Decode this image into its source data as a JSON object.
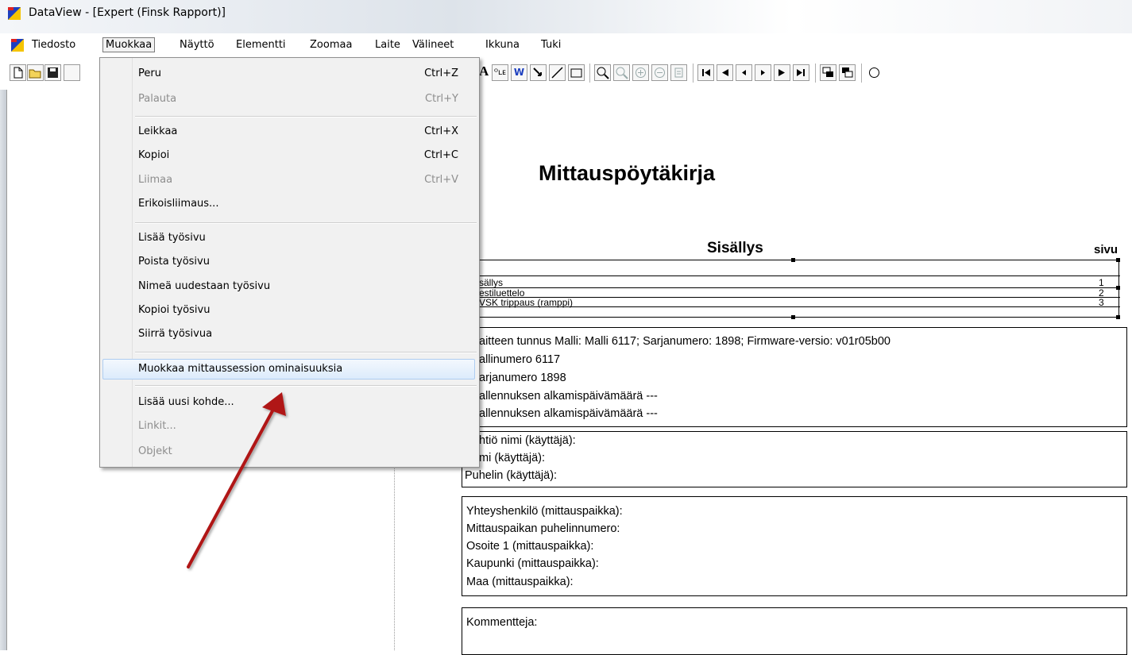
{
  "window": {
    "title": "DataView - [Expert (Finsk Rapport)]"
  },
  "menubar": {
    "items": [
      "Tiedosto",
      "Muokkaa",
      "Näyttö",
      "Elementti",
      "Zoomaa",
      "Laite",
      "Välineet",
      "Ikkuna",
      "Tuki"
    ],
    "active": "Muokkaa"
  },
  "toolbar": {
    "text_glyphs": [
      "A",
      "ᴼʟᴇ",
      "W"
    ]
  },
  "edit_menu": {
    "items": [
      {
        "label": "Peru",
        "shortcut": "Ctrl+Z",
        "enabled": true
      },
      {
        "label": "Palauta",
        "shortcut": "Ctrl+Y",
        "enabled": false
      },
      {
        "label": "Leikkaa",
        "shortcut": "Ctrl+X",
        "enabled": true
      },
      {
        "label": "Kopioi",
        "shortcut": "Ctrl+C",
        "enabled": true
      },
      {
        "label": "Liimaa",
        "shortcut": "Ctrl+V",
        "enabled": false
      },
      {
        "label": "Erikoisliimaus...",
        "shortcut": "",
        "enabled": true
      },
      {
        "label": "Lisää työsivu",
        "shortcut": "",
        "enabled": true
      },
      {
        "label": "Poista työsivu",
        "shortcut": "",
        "enabled": true
      },
      {
        "label": "Nimeä uudestaan työsivu",
        "shortcut": "",
        "enabled": true
      },
      {
        "label": "Kopioi työsivu",
        "shortcut": "",
        "enabled": true
      },
      {
        "label": "Siirrä työsivua",
        "shortcut": "",
        "enabled": true
      },
      {
        "label": "Muokkaa mittaussession ominaisuuksia",
        "shortcut": "",
        "enabled": true,
        "highlighted": true
      },
      {
        "label": "Lisää uusi kohde...",
        "shortcut": "",
        "enabled": true
      },
      {
        "label": "Linkit...",
        "shortcut": "",
        "enabled": false
      },
      {
        "label": "Objekt",
        "shortcut": "",
        "enabled": false
      }
    ]
  },
  "document": {
    "title": "Mittauspöytäkirja",
    "toc_heading": "Sisällys",
    "toc_page_heading": "sivu",
    "toc_entries": [
      {
        "label": "sällys",
        "page": "1"
      },
      {
        "label": "estiluettelo",
        "page": "2"
      },
      {
        "label": "VSK trippaus (ramppi)",
        "page": "3"
      }
    ],
    "device_box": [
      "aitteen tunnus Malli: Malli 6117; Sarjanumero: 1898; Firmware-versio: v01r05b00",
      "allinumero 6117",
      "arjanumero 1898",
      "allennuksen alkamispäivämäärä ---",
      "allennuksen alkamispäivämäärä ---"
    ],
    "user_box": [
      "htiö nimi (käyttäjä):",
      "mi (käyttäjä):",
      "Puhelin (käyttäjä):"
    ],
    "site_box": [
      "Yhteyshenkilö (mittauspaikka):",
      "Mittauspaikan puhelinnumero:",
      "Osoite 1 (mittauspaikka):",
      "Kaupunki (mittauspaikka):",
      "Maa (mittauspaikka):"
    ],
    "comment_box": [
      "Kommentteja:"
    ]
  },
  "colors": {
    "arrow": "#b01414",
    "menu_highlight": "#dcebfc",
    "app_icon_blue": "#1d3fbf",
    "app_icon_yellow": "#f5c400"
  }
}
